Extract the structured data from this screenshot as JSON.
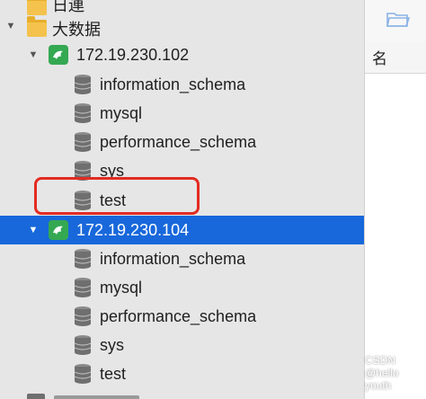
{
  "tree": {
    "top_folder_label": "日連",
    "group_label": "大数据",
    "connection_1": {
      "label": "172.19.230.102",
      "databases": [
        "information_schema",
        "mysql",
        "performance_schema",
        "sys",
        "test"
      ]
    },
    "connection_2": {
      "label": "172.19.230.104",
      "databases": [
        "information_schema",
        "mysql",
        "performance_schema",
        "sys",
        "test"
      ]
    }
  },
  "right_panel": {
    "column_header": "名"
  },
  "watermark": "CSDN @hello youth",
  "colors": {
    "selection": "#1868db",
    "highlight_box": "#e32b22",
    "connection_icon": "#35a852",
    "folder_icon": "#f4c24d"
  }
}
